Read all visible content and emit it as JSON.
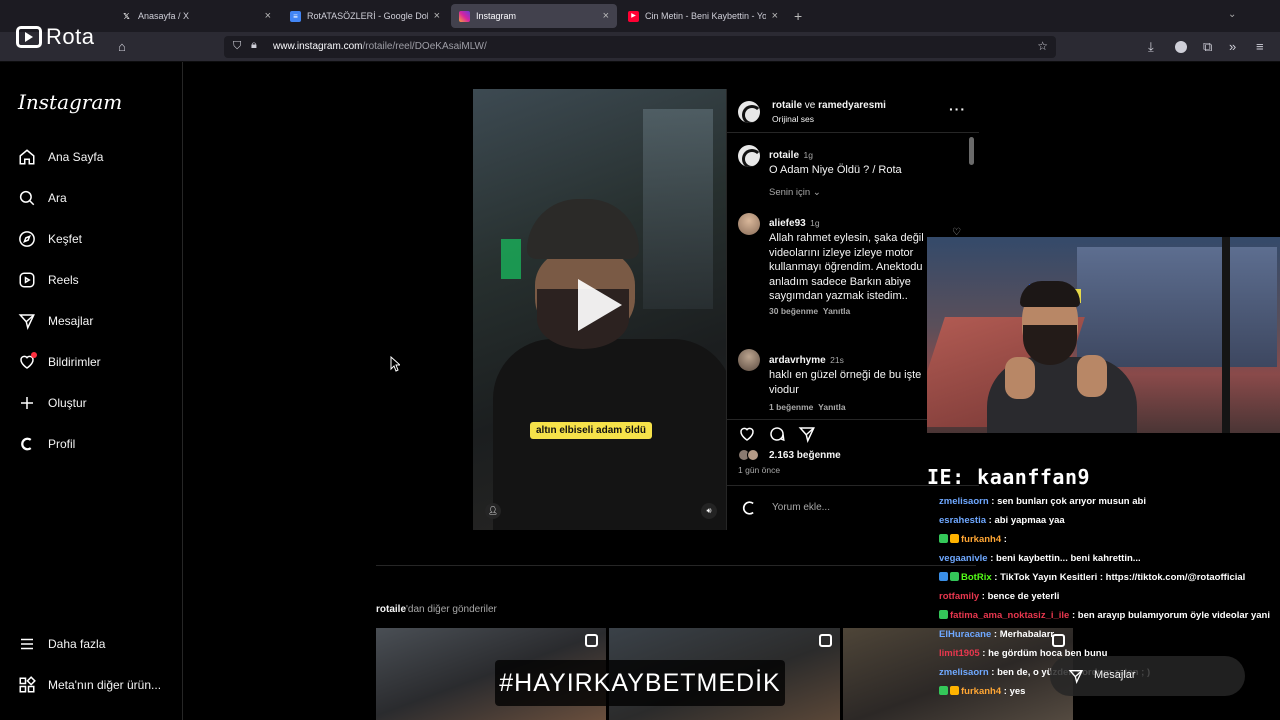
{
  "browser": {
    "tabs": [
      {
        "title": "Anasayfa / X",
        "favicon": "x-icon"
      },
      {
        "title": "RotATASÖZLERİ - Google Dokümanlar",
        "favicon": "docs-icon"
      },
      {
        "title": "Instagram",
        "favicon": "instagram-icon"
      },
      {
        "title": "Cin Metin - Beni Kaybettin - YouTube",
        "favicon": "youtube-icon"
      }
    ],
    "active_tab_index": 2,
    "url_host": "www.instagram.com",
    "url_path": "/rotaile/reel/DOeKAsaiMLW/"
  },
  "overlay_logo": {
    "text": "Rota"
  },
  "instagram": {
    "logo": "Instagram",
    "nav": [
      {
        "label": "Ana Sayfa",
        "icon": "home-icon"
      },
      {
        "label": "Ara",
        "icon": "search-icon"
      },
      {
        "label": "Keşfet",
        "icon": "compass-icon"
      },
      {
        "label": "Reels",
        "icon": "reels-icon"
      },
      {
        "label": "Mesajlar",
        "icon": "send-icon"
      },
      {
        "label": "Bildirimler",
        "icon": "heart-icon"
      },
      {
        "label": "Oluştur",
        "icon": "plus-icon"
      },
      {
        "label": "Profil",
        "icon": "profile-icon"
      }
    ],
    "nav_bottom": [
      {
        "label": "Daha fazla",
        "icon": "menu-icon"
      },
      {
        "label": "Meta'nın diğer ürün...",
        "icon": "meta-grid-icon"
      }
    ]
  },
  "post": {
    "author": "rotaile",
    "coauthor_connector": "ve",
    "coauthor": "ramedyaresmi",
    "audio": "Orijinal ses",
    "video_subtitle": "altın elbiseli adam öldü",
    "caption": {
      "user": "rotaile",
      "time": "1g",
      "text": "O Adam Niye Öldü ? / Rota"
    },
    "sort_label": "Senin için",
    "comments": [
      {
        "user": "aliefe93",
        "time": "1g",
        "text": "Allah rahmet eylesin, şaka değil videolarını izleye izleye motor kullanmayı öğrendim. Anektodu anladım sadece Barkın abiye saygımdan yazmak istedim..",
        "likes": "30 beğenme",
        "reply": "Yanıtla"
      },
      {
        "user": "ardavrhyme",
        "time": "21s",
        "text": "haklı en güzel örneği de bu işte viodur",
        "likes": "1 beğenme",
        "reply": "Yanıtla"
      }
    ],
    "likes": "2.163 beğenme",
    "posted": "1 gün önce",
    "comment_placeholder": "Yorum ekle..."
  },
  "more_posts": {
    "user": "rotaile",
    "suffix": "'dan diğer gönderiler"
  },
  "hashtag_banner": "#HAYIRKAYBETMEDİK",
  "messages_pill": "Mesajlar",
  "stream": {
    "chat_header": "IE: kaanffan9",
    "chat": [
      {
        "user": "zmelisaorn",
        "color": "#6fa8ff",
        "text": ": sen bunları çok arıyor musun abi"
      },
      {
        "user": "esrahestia",
        "color": "#6fa8ff",
        "text": ": abi yapmaa yaa"
      },
      {
        "user": "furkanh4",
        "color": "#ffa634",
        "text": ":",
        "badges": [
          "#34c759",
          "#ffb300"
        ]
      },
      {
        "user": "vegaanivle",
        "color": "#6fa8ff",
        "text": ": beni kaybettin... beni kahrettin..."
      },
      {
        "user": "BotRix",
        "color": "#53fc18",
        "text": ": TikTok Yayın Kesitleri : https://tiktok.com/@rotaofficial",
        "badges": [
          "#3a8ee6",
          "#34c759"
        ]
      },
      {
        "user": "rotfamily",
        "color": "#e8374e",
        "text": ": bence de yeterli"
      },
      {
        "user": "fatima_ama_noktasiz_i_ile",
        "color": "#e8374e",
        "text": ": ben arayıp bulamıyorum öyle videolar yani",
        "badges": [
          "#34c759"
        ]
      },
      {
        "user": "ElHuracane",
        "color": "#6fa8ff",
        "text": ": Merhabalarr"
      },
      {
        "user": "limit1905",
        "color": "#e8374e",
        "text": ": he gördüm hoca ben bunu"
      },
      {
        "user": "zmelisaorn",
        "color": "#6fa8ff",
        "text": ": ben de, o yüzden sordum zaten ; )"
      },
      {
        "user": "furkanh4",
        "color": "#ffa634",
        "text": ": yes",
        "badges": [
          "#34c759",
          "#ffb300"
        ]
      }
    ]
  }
}
